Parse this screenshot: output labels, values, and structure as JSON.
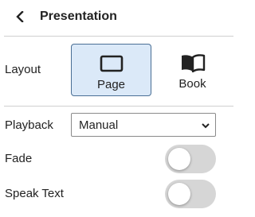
{
  "header": {
    "back_icon": "chevron-left-icon",
    "title": "Presentation"
  },
  "layout": {
    "label": "Layout",
    "selected": "Page",
    "options": [
      {
        "label": "Page",
        "icon": "page-icon"
      },
      {
        "label": "Book",
        "icon": "book-icon"
      }
    ]
  },
  "playback": {
    "label": "Playback",
    "value": "Manual",
    "icon": "chevron-down-icon"
  },
  "fade": {
    "label": "Fade",
    "on": false
  },
  "speak_text": {
    "label": "Speak Text",
    "on": false
  },
  "colors": {
    "selected_bg": "#dbe9f8",
    "selected_border": "#4a6f95",
    "toggle_off": "#d6d6d6"
  }
}
